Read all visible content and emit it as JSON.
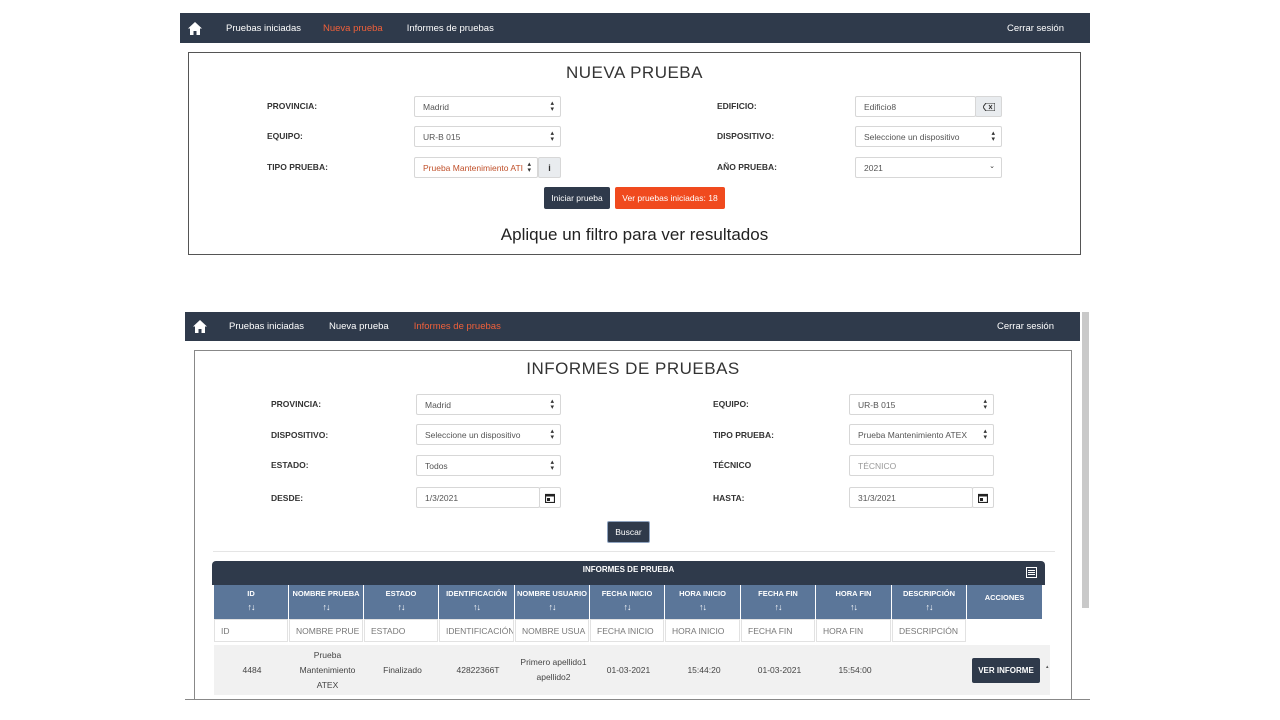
{
  "top": {
    "nav": {
      "items": [
        "Pruebas iniciadas",
        "Nueva prueba",
        "Informes de pruebas"
      ],
      "logout": "Cerrar sesión"
    },
    "title": "NUEVA PRUEBA",
    "form": {
      "provincia_label": "PROVINCIA:",
      "provincia_value": "Madrid",
      "equipo_label": "EQUIPO:",
      "equipo_value": "UR-B 015",
      "tipo_label": "TIPO PRUEBA:",
      "tipo_value": "Prueba Mantenimiento ATI",
      "edificio_label": "EDIFICIO:",
      "edificio_value": "Edificio8",
      "dispositivo_label": "DISPOSITIVO:",
      "dispositivo_value": "Seleccione un dispositivo",
      "anio_label": "AÑO PRUEBA:",
      "anio_value": "2021"
    },
    "buttons": {
      "start": "Iniciar prueba",
      "view": "Ver pruebas iniciadas: 18"
    },
    "hint": "Aplique un filtro para ver resultados"
  },
  "bottom": {
    "nav": {
      "items": [
        "Pruebas iniciadas",
        "Nueva prueba",
        "Informes de pruebas"
      ],
      "logout": "Cerrar sesión"
    },
    "title": "INFORMES DE PRUEBAS",
    "form": {
      "provincia_label": "PROVINCIA:",
      "provincia_value": "Madrid",
      "equipo_label": "EQUIPO:",
      "equipo_value": "UR-B 015",
      "dispositivo_label": "DISPOSITIVO:",
      "dispositivo_value": "Seleccione un dispositivo",
      "tipo_label": "TIPO PRUEBA:",
      "tipo_value": "Prueba Mantenimiento ATEX",
      "estado_label": "ESTADO:",
      "estado_value": "Todos",
      "tecnico_label": "TÉCNICO",
      "tecnico_placeholder": "TÉCNICO",
      "desde_label": "DESDE:",
      "desde_value": "1/3/2021",
      "hasta_label": "HASTA:",
      "hasta_value": "31/3/2021"
    },
    "search_button": "Buscar",
    "table": {
      "title": "INFORMES DE PRUEBA",
      "columns": [
        "ID",
        "NOMBRE PRUEBA",
        "ESTADO",
        "IDENTIFICACIÓN",
        "NOMBRE USUARIO",
        "FECHA INICIO",
        "HORA INICIO",
        "FECHA FIN",
        "HORA FIN",
        "DESCRIPCIÓN",
        "ACCIONES"
      ],
      "filters": [
        "ID",
        "NOMBRE PRUE",
        "ESTADO",
        "IDENTIFICACIÓN",
        "NOMBRE USUA",
        "FECHA INICIO",
        "HORA INICIO",
        "FECHA FIN",
        "HORA FIN",
        "DESCRIPCIÓN"
      ],
      "rows": [
        {
          "id": "4484",
          "nombre_l1": "Prueba",
          "nombre_l2": "Mantenimiento",
          "nombre_l3": "ATEX",
          "estado": "Finalizado",
          "identificacion": "42822366T",
          "usuario_l1": "Primero apellido1",
          "usuario_l2": "apellido2",
          "fecha_inicio": "01-03-2021",
          "hora_inicio": "15:44:20",
          "fecha_fin": "01-03-2021",
          "hora_fin": "15:54:00",
          "descripcion": "",
          "action": "VER INFORME"
        }
      ]
    }
  }
}
